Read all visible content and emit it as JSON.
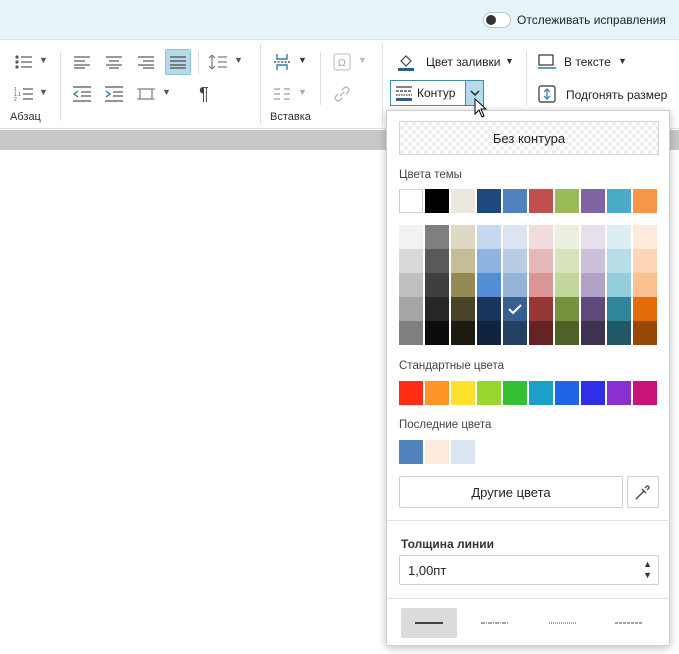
{
  "topbar": {
    "track_changes_label": "Отслеживать исправления",
    "track_changes_on": false
  },
  "ribbon": {
    "paragraph_label": "Абзац",
    "insert_label": "Вставка",
    "fill_color_label": "Цвет заливки",
    "in_text_label": "В тексте",
    "contour_label": "Контур",
    "fit_size_label": "Подгонять размер"
  },
  "popup": {
    "no_contour_label": "Без контура",
    "theme_colors_title": "Цвета темы",
    "standard_colors_title": "Стандартные цвета",
    "recent_colors_title": "Последние цвета",
    "other_colors_label": "Другие цвета",
    "line_thickness_title": "Толщина линии",
    "line_thickness_value": "1,00пт",
    "theme_colors": [
      "#ffffff",
      "#000000",
      "#ece8df",
      "#1f487c",
      "#4f81bd",
      "#c0504e",
      "#9bbb59",
      "#8064a2",
      "#4bacc6",
      "#f79646"
    ],
    "theme_shades": [
      [
        "#f2f2f2",
        "#7f7f7f",
        "#ddd9c3",
        "#c6d9f1",
        "#dbe5f1",
        "#f2dcdb",
        "#ebf1de",
        "#e5e0ec",
        "#dbeef4",
        "#fdeada"
      ],
      [
        "#d9d9d9",
        "#595959",
        "#c4bd97",
        "#8db3e2",
        "#b8cce4",
        "#e5b9b8",
        "#d7e3bc",
        "#ccc1d9",
        "#b7dde8",
        "#fbd5b5"
      ],
      [
        "#bfbfbf",
        "#3f3f3f",
        "#938953",
        "#548dd4",
        "#95b3d7",
        "#d99694",
        "#c3d69b",
        "#b2a2c7",
        "#92cddc",
        "#fac08f"
      ],
      [
        "#a6a6a6",
        "#262626",
        "#494429",
        "#17365d",
        "#366092",
        "#953735",
        "#76923c",
        "#5f497a",
        "#31859b",
        "#e36c09"
      ],
      [
        "#7f7f7f",
        "#0c0c0c",
        "#1d1b10",
        "#0f243e",
        "#244061",
        "#632423",
        "#4f6128",
        "#3f3151",
        "#205867",
        "#974806"
      ]
    ],
    "selected_shade": {
      "row": 3,
      "col": 4
    },
    "standard_colors": [
      "#ff2e12",
      "#fe9526",
      "#fee12d",
      "#98d72e",
      "#36c134",
      "#1ba1c7",
      "#2264e6",
      "#2f2fe8",
      "#8a2fd2",
      "#c8137a"
    ],
    "recent_colors": [
      "#4f81bd",
      "#fdeada",
      "#dbe5f1"
    ],
    "line_styles": [
      "solid",
      "dash-dot",
      "dotted",
      "dashed"
    ],
    "selected_line_style": 0
  }
}
